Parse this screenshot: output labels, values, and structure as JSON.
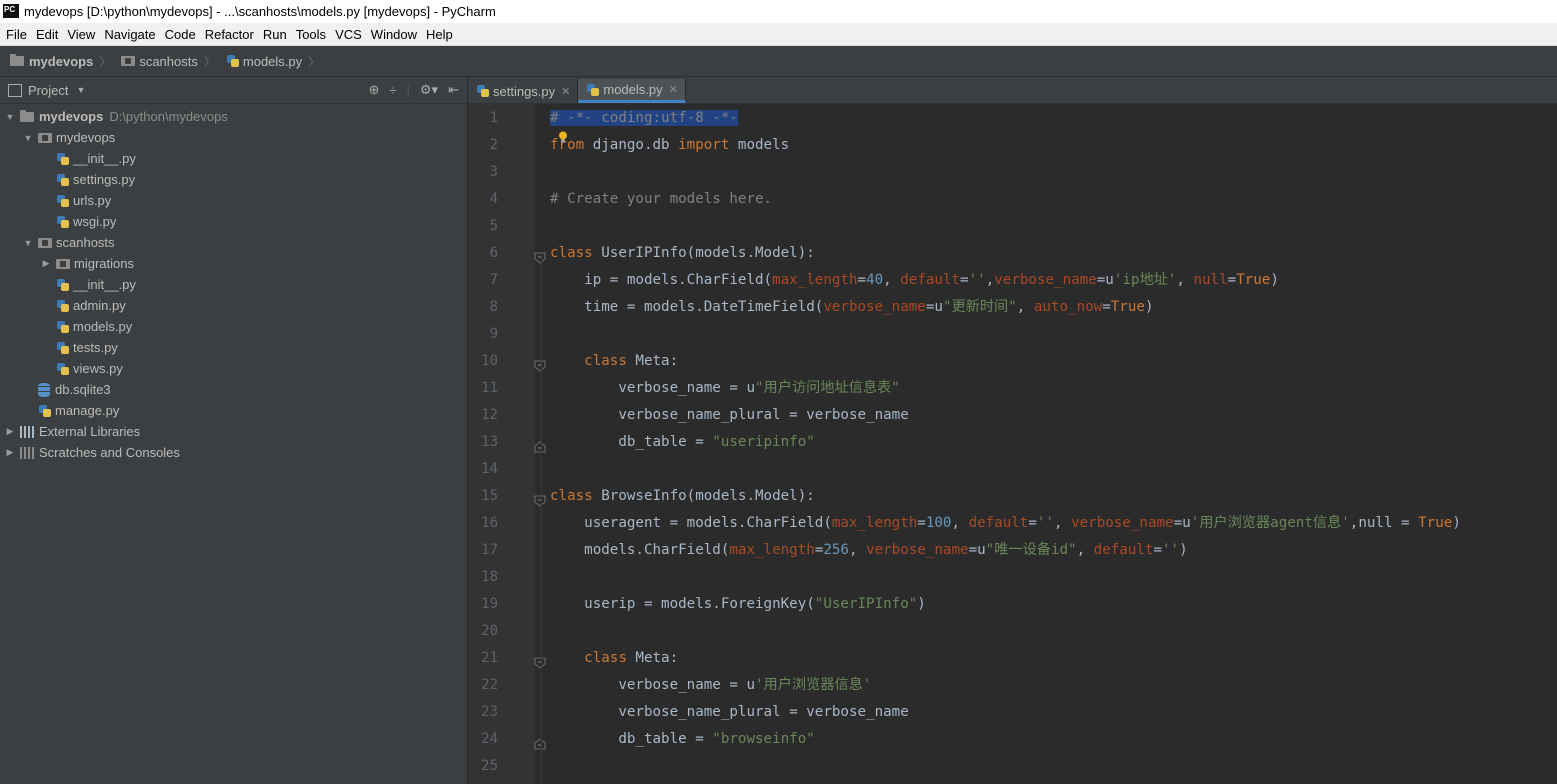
{
  "window": {
    "title": "mydevops [D:\\python\\mydevops] - ...\\scanhosts\\models.py [mydevops] - PyCharm",
    "logo": "PC"
  },
  "menu": [
    "File",
    "Edit",
    "View",
    "Navigate",
    "Code",
    "Refactor",
    "Run",
    "Tools",
    "VCS",
    "Window",
    "Help"
  ],
  "breadcrumbs": [
    "mydevops",
    "scanhosts",
    "models.py"
  ],
  "project": {
    "header": "Project",
    "tree": [
      {
        "label": "mydevops",
        "hint": "D:\\python\\mydevops",
        "type": "root",
        "level": 0,
        "expanded": true
      },
      {
        "label": "mydevops",
        "type": "package",
        "level": 1,
        "expanded": true
      },
      {
        "label": "__init__.py",
        "type": "py",
        "level": 2
      },
      {
        "label": "settings.py",
        "type": "py",
        "level": 2
      },
      {
        "label": "urls.py",
        "type": "py",
        "level": 2
      },
      {
        "label": "wsgi.py",
        "type": "py",
        "level": 2
      },
      {
        "label": "scanhosts",
        "type": "package",
        "level": 1,
        "expanded": true
      },
      {
        "label": "migrations",
        "type": "package",
        "level": 2,
        "expanded": false
      },
      {
        "label": "__init__.py",
        "type": "py",
        "level": 2
      },
      {
        "label": "admin.py",
        "type": "py",
        "level": 2
      },
      {
        "label": "models.py",
        "type": "py",
        "level": 2
      },
      {
        "label": "tests.py",
        "type": "py",
        "level": 2
      },
      {
        "label": "views.py",
        "type": "py",
        "level": 2
      },
      {
        "label": "db.sqlite3",
        "type": "db",
        "level": 1
      },
      {
        "label": "manage.py",
        "type": "py",
        "level": 1
      },
      {
        "label": "External Libraries",
        "type": "lib",
        "level": 0,
        "expanded": false
      },
      {
        "label": "Scratches and Consoles",
        "type": "scratch",
        "level": 0,
        "expanded": false
      }
    ]
  },
  "tabs": [
    {
      "label": "settings.py",
      "active": false
    },
    {
      "label": "models.py",
      "active": true
    }
  ],
  "code_lines": [
    "# -*- coding:utf-8 -*-",
    "from django.db import models",
    "",
    "# Create your models here.",
    "",
    "class UserIPInfo(models.Model):",
    "    ip = models.CharField(max_length=40, default='',verbose_name=u'ip地址', null=True)",
    "    time = models.DateTimeField(verbose_name=u\"更新时间\", auto_now=True)",
    "",
    "    class Meta:",
    "        verbose_name = u\"用户访问地址信息表\"",
    "        verbose_name_plural = verbose_name",
    "        db_table = \"useripinfo\"",
    "",
    "class BrowseInfo(models.Model):",
    "    useragent = models.CharField(max_length=100, default='', verbose_name=u'用户浏览器agent信息',null = True)",
    "    models.CharField(max_length=256, verbose_name=u\"唯一设备id\", default='')",
    "",
    "    userip = models.ForeignKey(\"UserIPInfo\")",
    "",
    "    class Meta:",
    "        verbose_name = u'用户浏览器信息'",
    "        verbose_name_plural = verbose_name",
    "        db_table = \"browseinfo\"",
    ""
  ]
}
